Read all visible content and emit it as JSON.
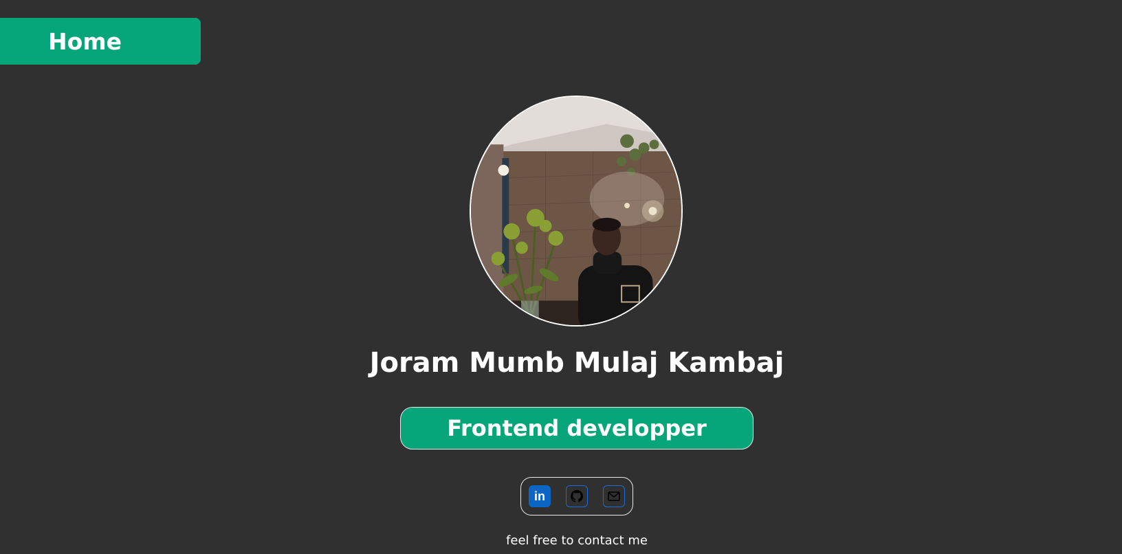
{
  "nav": {
    "home_label": "Home"
  },
  "profile": {
    "name": "Joram Mumb Mulaj Kambaj",
    "role": "Frontend developper",
    "photo_icon": "profile-photo"
  },
  "social": {
    "linkedin_glyph": "in",
    "icons": [
      "linkedin-icon",
      "github-icon",
      "mail-icon"
    ]
  },
  "footer": {
    "contact_text": "feel free to contact me"
  },
  "colors": {
    "background": "#303030",
    "accent": "#07a67a",
    "linkedin": "#0a66c2",
    "icon_border": "#1c6bd6"
  }
}
